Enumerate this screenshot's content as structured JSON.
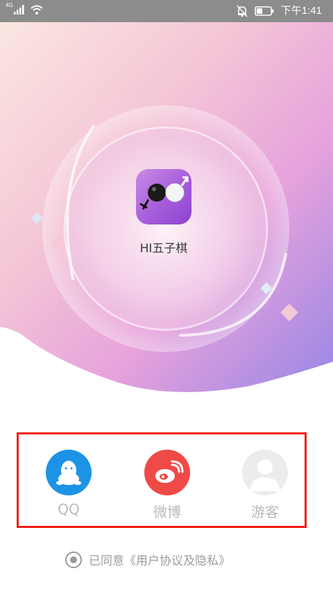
{
  "status_bar": {
    "network": "4G",
    "time": "下午1:41"
  },
  "app": {
    "name": "HI五子棋"
  },
  "login": {
    "options": [
      {
        "label": "QQ",
        "icon": "qq-penguin-icon",
        "color": "#1d93e6"
      },
      {
        "label": "微博",
        "icon": "weibo-icon",
        "color": "#ef4a46"
      },
      {
        "label": "游客",
        "icon": "guest-user-icon",
        "color": "#ececec"
      }
    ],
    "highlight_color": "#f01b12"
  },
  "agreement": {
    "text": "已同意《用户协议及隐私》",
    "checked": true
  },
  "colors": {
    "status_bar": "#8c8c8c",
    "gradient_start": "#fbe3e3",
    "gradient_mid": "#e4a6de",
    "gradient_end": "#9c84e6"
  }
}
